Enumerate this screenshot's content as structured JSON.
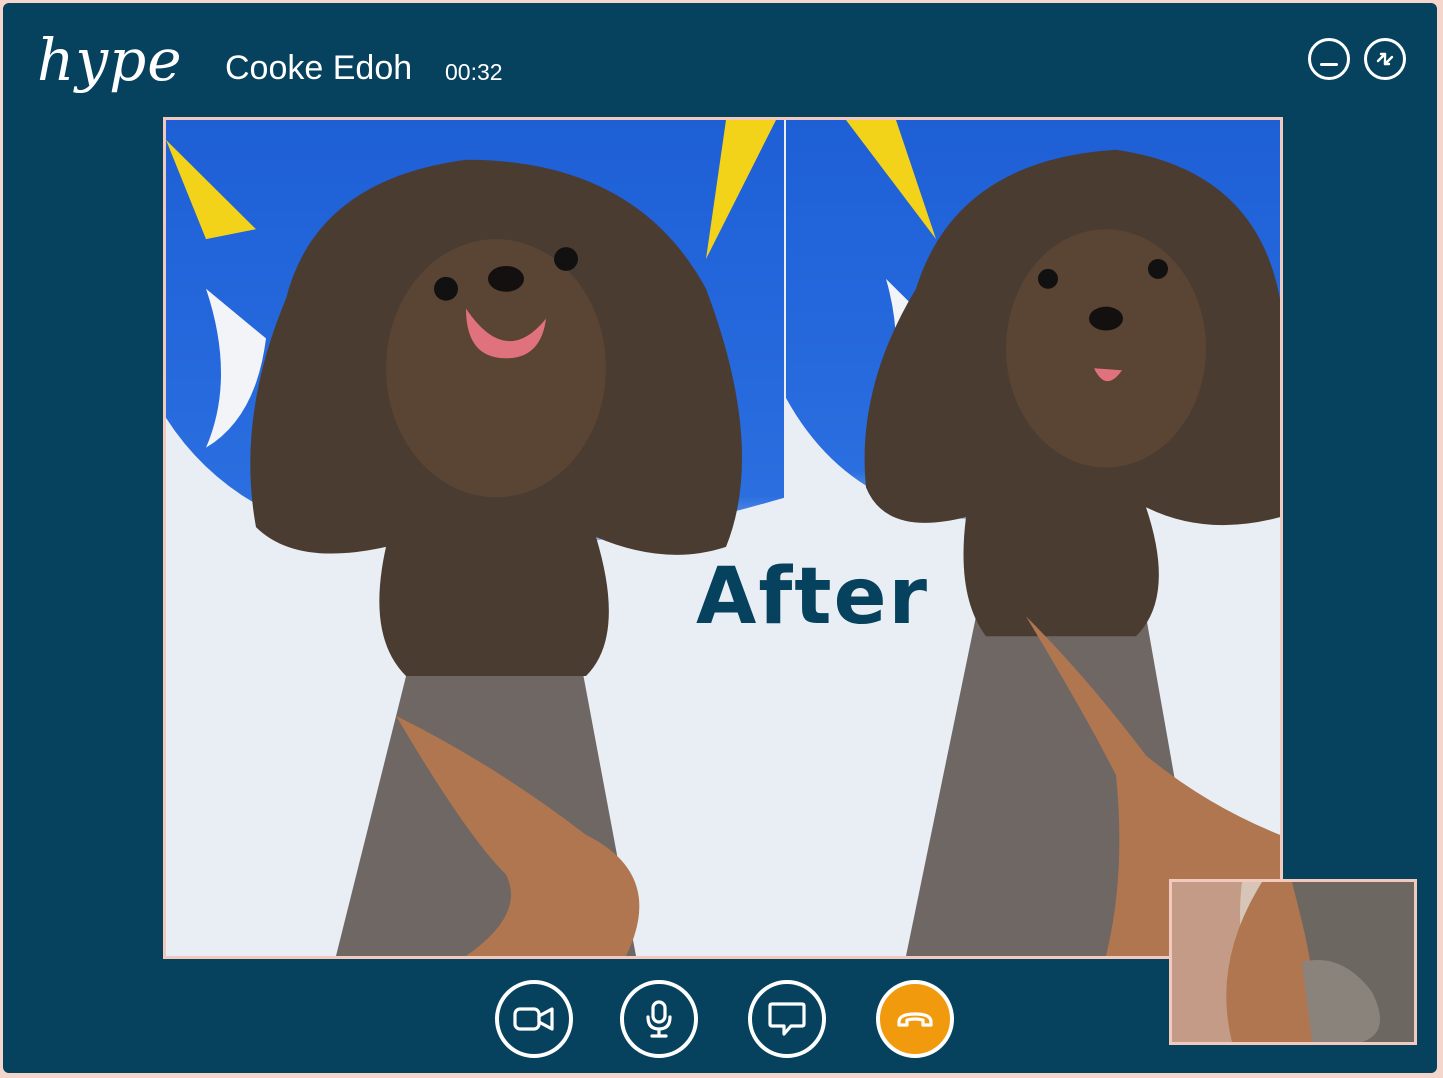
{
  "app": {
    "logo": "hype"
  },
  "call": {
    "caller_name": "Cooke Edoh",
    "duration": "00:32"
  },
  "window_controls": {
    "minimize_icon": "minimize-icon",
    "swap_icon": "swap-icon"
  },
  "video": {
    "overlay_text": "After"
  },
  "controls": {
    "camera_icon": "video-camera-icon",
    "mic_icon": "microphone-icon",
    "chat_icon": "chat-bubble-icon",
    "end_icon": "phone-hangup-icon"
  },
  "colors": {
    "background": "#06425e",
    "frame_border": "#f1c9bd",
    "end_call": "#f29a0e",
    "text": "#ffffff"
  }
}
